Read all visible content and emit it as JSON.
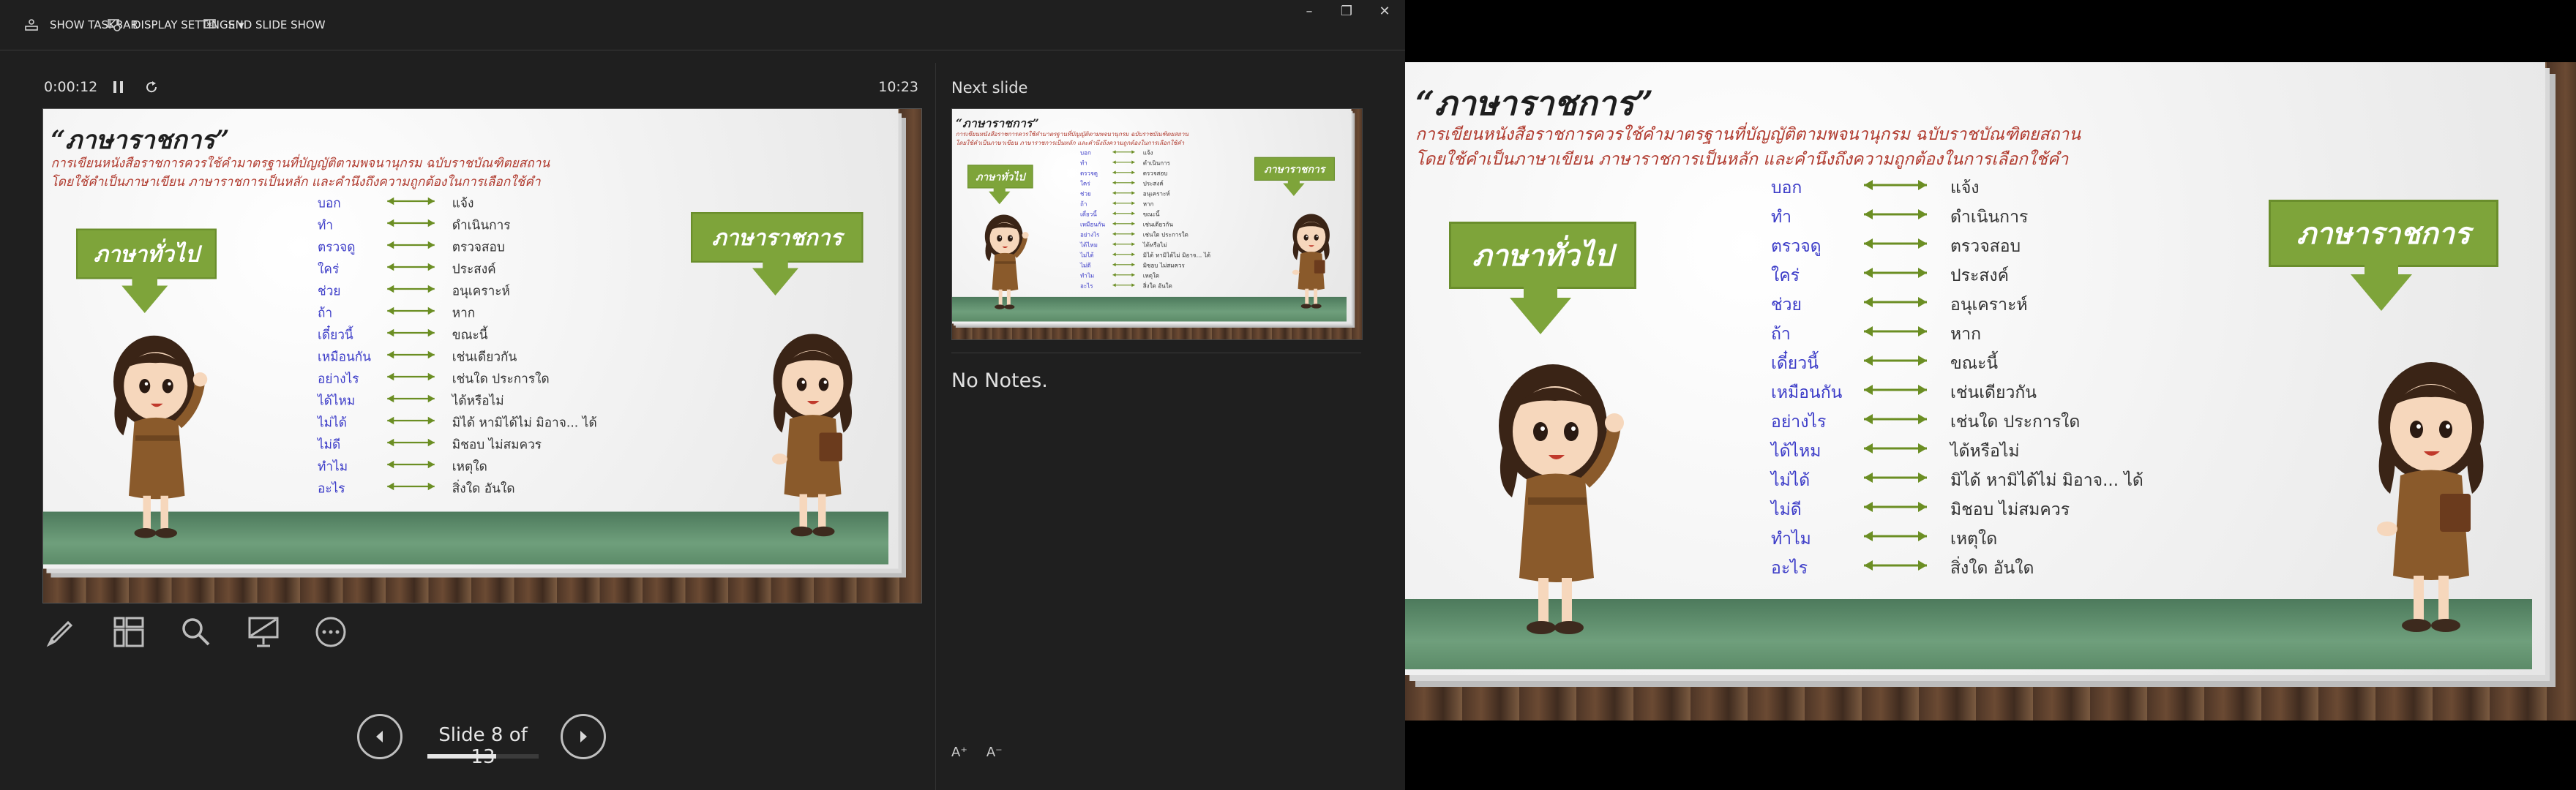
{
  "window": {
    "toolbar": {
      "show_taskbar": "SHOW TASKBAR",
      "display_settings": "DISPLAY SETTINGS ▾",
      "end_slide_show": "END SLIDE SHOW"
    },
    "controls": {
      "minimize": "–",
      "restore": "❐",
      "close": "✕"
    }
  },
  "presenter": {
    "timer": "0:00:12",
    "clock": "10:23",
    "next_label": "Next slide",
    "notes": "No Notes.",
    "notes_tools": [
      "A⁺",
      "A⁻"
    ],
    "slide_counter": "Slide 8 of 13",
    "progress": 0.6154,
    "tools": [
      "pen-tool-icon",
      "see-all-slides-icon",
      "zoom-icon",
      "black-screen-icon",
      "more-options-icon"
    ]
  },
  "slide": {
    "title": "“ภาษาราชการ”",
    "subtitle_line1": "การเขียนหนังสือราชการควรใช้คำมาตรฐานที่บัญญัติตามพจนานุกรม ฉบับราชบัณฑิตยสถาน",
    "subtitle_line2": "โดยใช้คำเป็นภาษาเขียน ภาษาราชการเป็นหลัก และคำนึงถึงความถูกต้องในการเลือกใช้คำ",
    "left_box": "ภาษาทั่วไป",
    "right_box": "ภาษาราชการ",
    "words": [
      {
        "general": "บอก",
        "official": "แจ้ง"
      },
      {
        "general": "ทำ",
        "official": "ดำเนินการ"
      },
      {
        "general": "ตรวจดู",
        "official": "ตรวจสอบ"
      },
      {
        "general": "ใคร่",
        "official": "ประสงค์"
      },
      {
        "general": "ช่วย",
        "official": "อนุเคราะห์"
      },
      {
        "general": "ถ้า",
        "official": "หาก"
      },
      {
        "general": "เดี๋ยวนี้",
        "official": "ขณะนี้"
      },
      {
        "general": "เหมือนกัน",
        "official": "เช่นเดียวกัน"
      },
      {
        "general": "อย่างไร",
        "official": "เช่นใด ประการใด"
      },
      {
        "general": "ได้ไหม",
        "official": "ได้หรือไม่"
      },
      {
        "general": "ไม่ได้",
        "official": "มิได้ หามิได้ไม่ มิอาจ... ได้"
      },
      {
        "general": "ไม่ดี",
        "official": "มิชอบ ไม่สมควร"
      },
      {
        "general": "ทำไม",
        "official": "เหตุใด"
      },
      {
        "general": "อะไร",
        "official": "สิ่งใด อันใด"
      }
    ],
    "colors": {
      "box_green": "#7ea43a",
      "word_blue": "#3c3cc8",
      "subtitle_red": "#b03a2e",
      "floor_green": "#5c8b68"
    }
  }
}
